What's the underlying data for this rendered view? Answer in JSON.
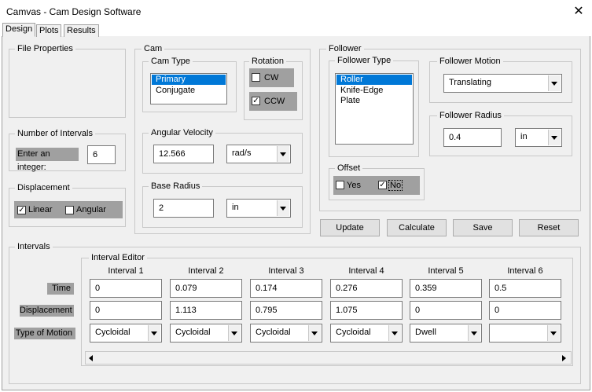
{
  "window": {
    "title": "Camvas - Cam Design Software",
    "close_glyph": "✕"
  },
  "tabs": [
    "Design",
    "Plots",
    "Results"
  ],
  "file_properties": {
    "label": "File Properties"
  },
  "intervals_count": {
    "label": "Number of Intervals",
    "prompt": "Enter an integer:",
    "value": "6"
  },
  "displacement": {
    "label": "Displacement",
    "linear": "Linear",
    "angular": "Angular"
  },
  "cam": {
    "label": "Cam",
    "type_label": "Cam Type",
    "types": [
      "Primary",
      "Conjugate"
    ],
    "rotation_label": "Rotation",
    "cw": "CW",
    "ccw": "CCW",
    "angular_velocity_label": "Angular Velocity",
    "angular_velocity_value": "12.566",
    "angular_velocity_unit": "rad/s",
    "base_radius_label": "Base Radius",
    "base_radius_value": "2",
    "base_radius_unit": "in"
  },
  "follower": {
    "label": "Follower",
    "type_label": "Follower Type",
    "types": [
      "Roller",
      "Knife-Edge",
      "Plate"
    ],
    "motion_label": "Follower Motion",
    "motion_value": "Translating",
    "radius_label": "Follower Radius",
    "radius_value": "0.4",
    "radius_unit": "in",
    "offset_label": "Offset",
    "yes": "Yes",
    "no": "No"
  },
  "actions": {
    "update": "Update",
    "calculate": "Calculate",
    "save": "Save",
    "reset": "Reset"
  },
  "intervals": {
    "label": "Intervals",
    "editor_label": "Interval Editor",
    "row_labels": {
      "time": "Time",
      "displacement": "Displacement",
      "motion": "Type of Motion"
    },
    "columns": [
      {
        "header": "Interval 1",
        "time": "0",
        "disp": "0",
        "motion": "Cycloidal"
      },
      {
        "header": "Interval 2",
        "time": "0.079",
        "disp": "1.113",
        "motion": "Cycloidal"
      },
      {
        "header": "Interval 3",
        "time": "0.174",
        "disp": "0.795",
        "motion": "Cycloidal"
      },
      {
        "header": "Interval 4",
        "time": "0.276",
        "disp": "1.075",
        "motion": "Cycloidal"
      },
      {
        "header": "Interval 5",
        "time": "0.359",
        "disp": "0",
        "motion": "Dwell"
      },
      {
        "header": "Interval 6",
        "time": "0.5",
        "disp": "0",
        "motion": ""
      }
    ]
  },
  "colors": {
    "selection": "#0078d7",
    "panel": "#f0f0f0",
    "label_bg": "#a0a0a0"
  }
}
